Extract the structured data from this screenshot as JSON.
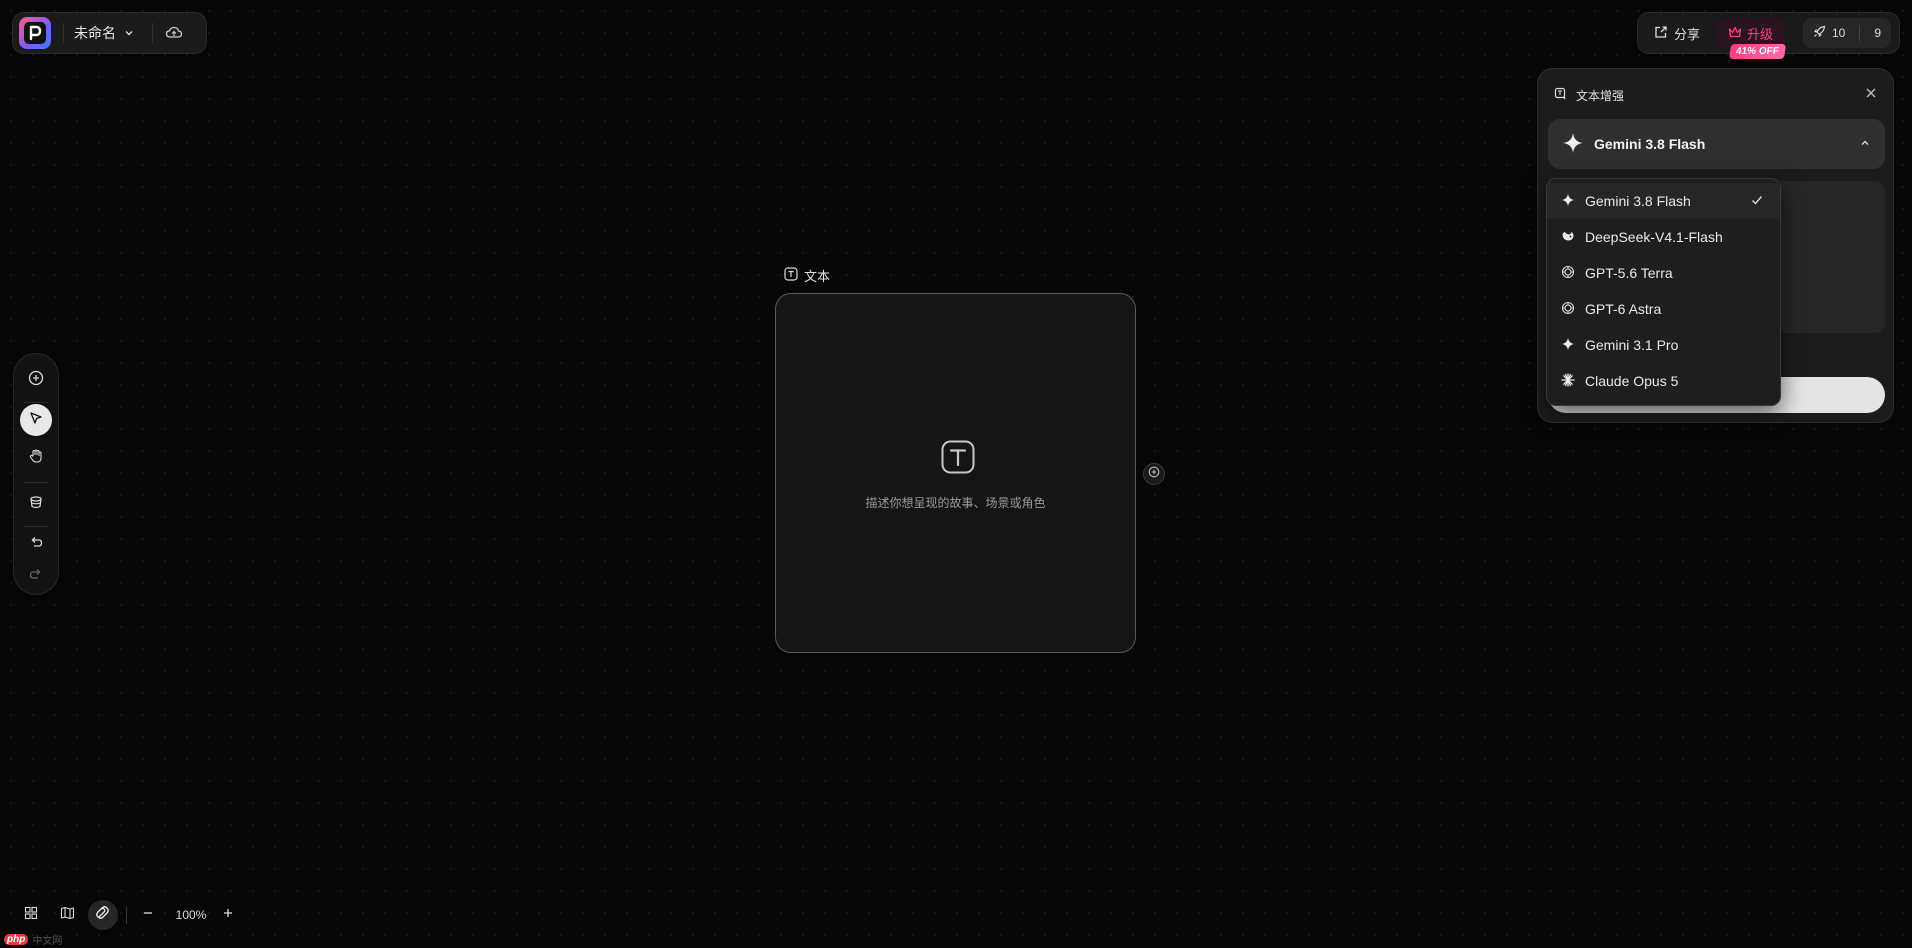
{
  "header": {
    "project_name": "未命名",
    "share_label": "分享",
    "upgrade_label": "升级",
    "discount_badge": "41% OFF",
    "credits": "10",
    "count": "9"
  },
  "panel": {
    "title": "文本增强",
    "selected_model": "Gemini 3.8 Flash"
  },
  "dropdown": {
    "items": [
      {
        "label": "Gemini 3.8 Flash",
        "icon": "gemini-star-icon",
        "selected": true
      },
      {
        "label": "DeepSeek-V4.1-Flash",
        "icon": "deepseek-whale-icon",
        "selected": false
      },
      {
        "label": "GPT-5.6 Terra",
        "icon": "openai-icon",
        "selected": false
      },
      {
        "label": "GPT-6 Astra",
        "icon": "openai-icon",
        "selected": false
      },
      {
        "label": "Gemini 3.1 Pro",
        "icon": "gemini-star-icon",
        "selected": false
      },
      {
        "label": "Claude Opus 5",
        "icon": "claude-burst-icon",
        "selected": false
      }
    ]
  },
  "node": {
    "label": "文本",
    "hint": "描述你想呈现的故事、场景或角色"
  },
  "toolbar": {
    "zoom": "100%"
  },
  "watermark": {
    "logo": "php",
    "site": "中文网"
  },
  "colors": {
    "accent_pink": "#ff3d86",
    "canvas_bg": "#060606",
    "panel_bg": "#1c1c1c"
  }
}
